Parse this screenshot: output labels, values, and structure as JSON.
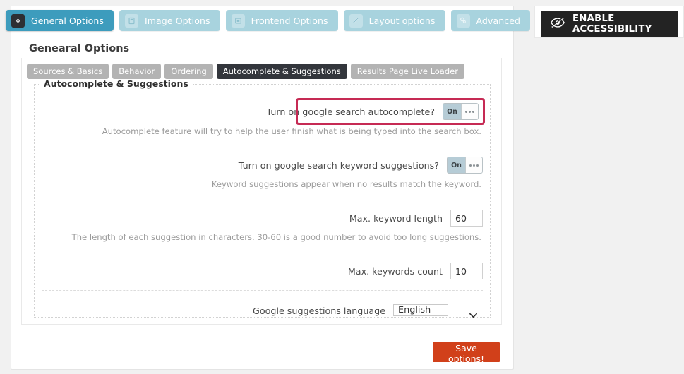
{
  "top_tabs": [
    {
      "label": "General Options",
      "icon": "gear-icon",
      "active": true
    },
    {
      "label": "Image Options",
      "icon": "image-icon",
      "active": false
    },
    {
      "label": "Frontend Options",
      "icon": "monitor-icon",
      "active": false
    },
    {
      "label": "Layout options",
      "icon": "pencil-icon",
      "active": false
    },
    {
      "label": "Advanced",
      "icon": "settings-icon",
      "active": false
    }
  ],
  "section": {
    "title": "Genearal Options"
  },
  "sub_tabs": [
    {
      "label": "Sources & Basics",
      "active": false
    },
    {
      "label": "Behavior",
      "active": false
    },
    {
      "label": "Ordering",
      "active": false
    },
    {
      "label": "Autocomplete & Suggestions",
      "active": true
    },
    {
      "label": "Results Page Live Loader",
      "active": false
    }
  ],
  "fieldset": {
    "legend": "Autocomplete & Suggestions",
    "rows": [
      {
        "label": "Turn on google search autocomplete?",
        "control": "toggle",
        "value": "On",
        "description": "Autocomplete feature will try to help the user finish what is being typed into the search box.",
        "highlighted": true
      },
      {
        "label": "Turn on google search keyword suggestions?",
        "control": "toggle",
        "value": "On",
        "description": "Keyword suggestions appear when no results match the keyword.",
        "highlighted": false
      },
      {
        "label": "Max. keyword length",
        "control": "number",
        "value": "60",
        "description": "The length of each suggestion in characters. 30-60 is a good number to avoid too long suggestions.",
        "highlighted": false
      },
      {
        "label": "Max. keywords count",
        "control": "number",
        "value": "10",
        "description": "",
        "highlighted": false
      },
      {
        "label": "Google suggestions language",
        "control": "select",
        "value": "English",
        "description": "",
        "highlighted": false
      }
    ]
  },
  "save": {
    "label": "Save options!"
  },
  "accessibility": {
    "label": "ENABLE ACCESSIBILITY",
    "icon": "eye-slash-icon"
  },
  "colors": {
    "active_tab": "#3d9cbd",
    "inactive_tab": "#a8d3de",
    "sub_tab_active": "#33363c",
    "sub_tab": "#b3b3b3",
    "save_button": "#d1401a",
    "highlight_ring": "#c62a54",
    "accessibility_bar": "#232323",
    "toggle_on": "#b6ccd6",
    "page_background": "#f1f1f1"
  }
}
